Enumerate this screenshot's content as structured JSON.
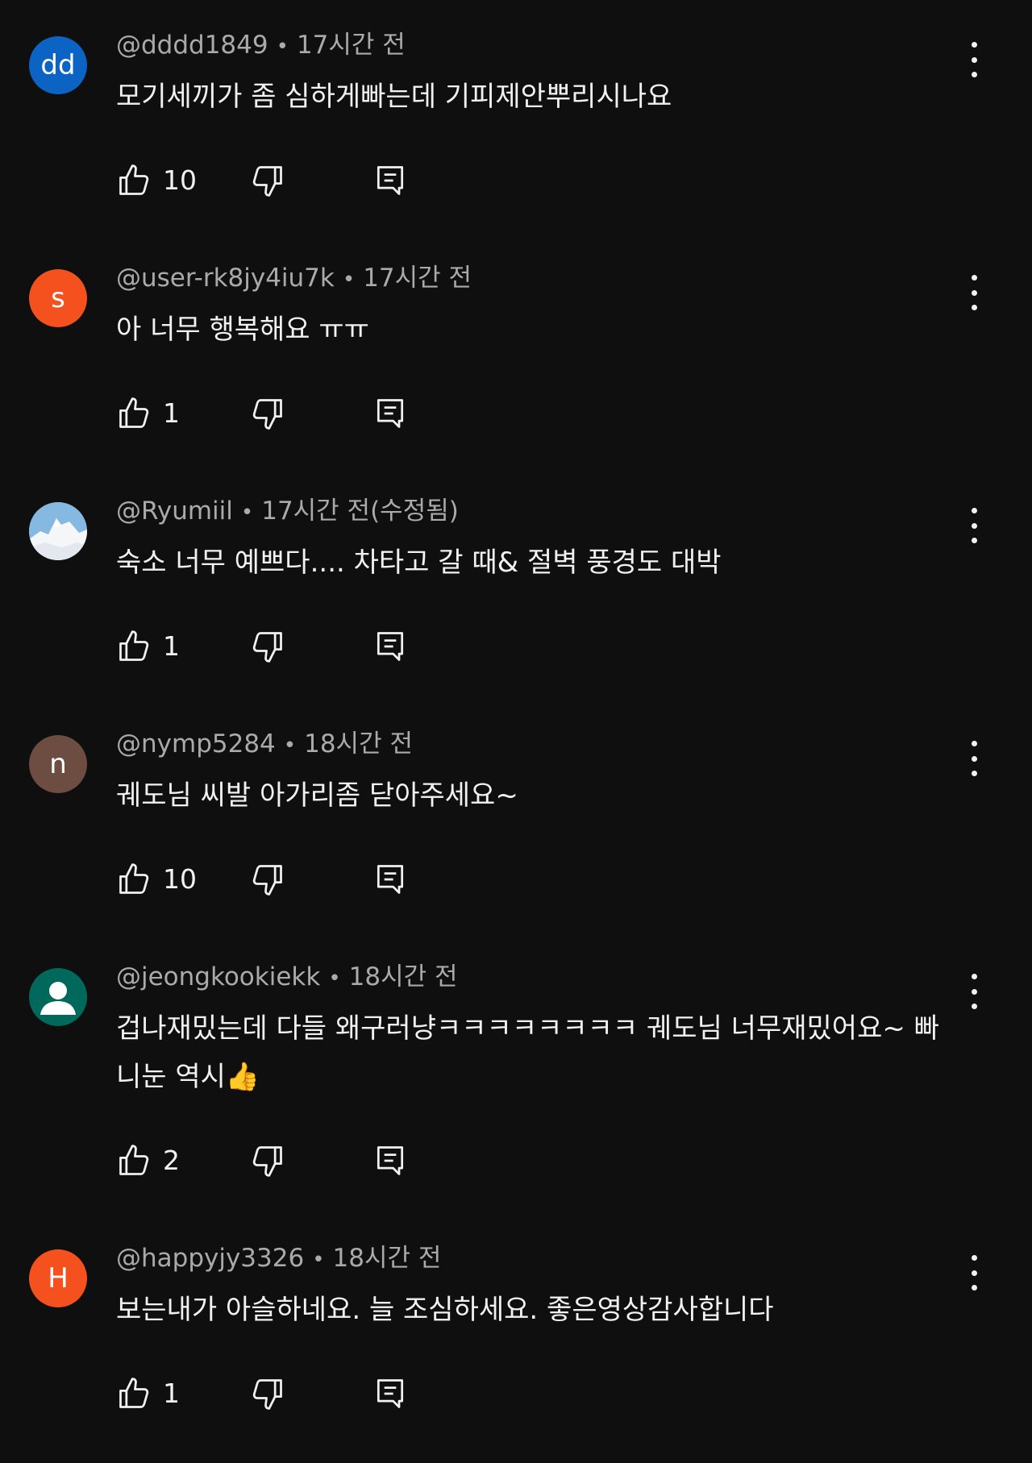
{
  "comments": [
    {
      "author": "@dddd1849",
      "time": "17시간 전",
      "text": "모기세끼가 좀 심하게빠는데 기피제안뿌리시나요",
      "likes": "10",
      "avatar": {
        "type": "initials",
        "label": "dd",
        "bg": "#0b63c4"
      }
    },
    {
      "author": "@user-rk8jy4iu7k",
      "time": "17시간 전",
      "text": "아 너무 행복해요 ㅠㅠ",
      "likes": "1",
      "avatar": {
        "type": "initials",
        "label": "s",
        "bg": "#f4511e"
      }
    },
    {
      "author": "@Ryumiil",
      "time": "17시간 전(수정됨)",
      "text": "숙소 너무 예쁘다.... 차타고 갈 때& 절벽 풍경도 대박",
      "likes": "1",
      "avatar": {
        "type": "photo",
        "label": "",
        "bg": "#7fb2de"
      }
    },
    {
      "author": "@nymp5284",
      "time": "18시간 전",
      "text": "궤도님 씨발 아가리좀 닫아주세요~",
      "likes": "10",
      "avatar": {
        "type": "initials",
        "label": "n",
        "bg": "#6d4c41"
      }
    },
    {
      "author": "@jeongkookiekk",
      "time": "18시간 전",
      "text": "겁나재밌는데 다들 왜구러냥ㅋㅋㅋㅋㅋㅋㅋㅋ 궤도님 너무재밌어요~ 빠니눈 역시👍",
      "likes": "2",
      "avatar": {
        "type": "person",
        "label": "",
        "bg": "#00695c"
      }
    },
    {
      "author": "@happyjy3326",
      "time": "18시간 전",
      "text": "보는내가 아슬하네요. 늘 조심하세요.  좋은영상감사합니다",
      "likes": "1",
      "avatar": {
        "type": "initials",
        "label": "H",
        "bg": "#f4511e"
      }
    }
  ],
  "icons": {
    "like": "thumb-up-icon",
    "dislike": "thumb-down-icon",
    "reply": "reply-comment-icon",
    "more": "more-vertical-icon"
  },
  "colors": {
    "background": "#0f0f0f",
    "text": "#f1f1f1",
    "secondary_text": "#aaaaaa"
  }
}
